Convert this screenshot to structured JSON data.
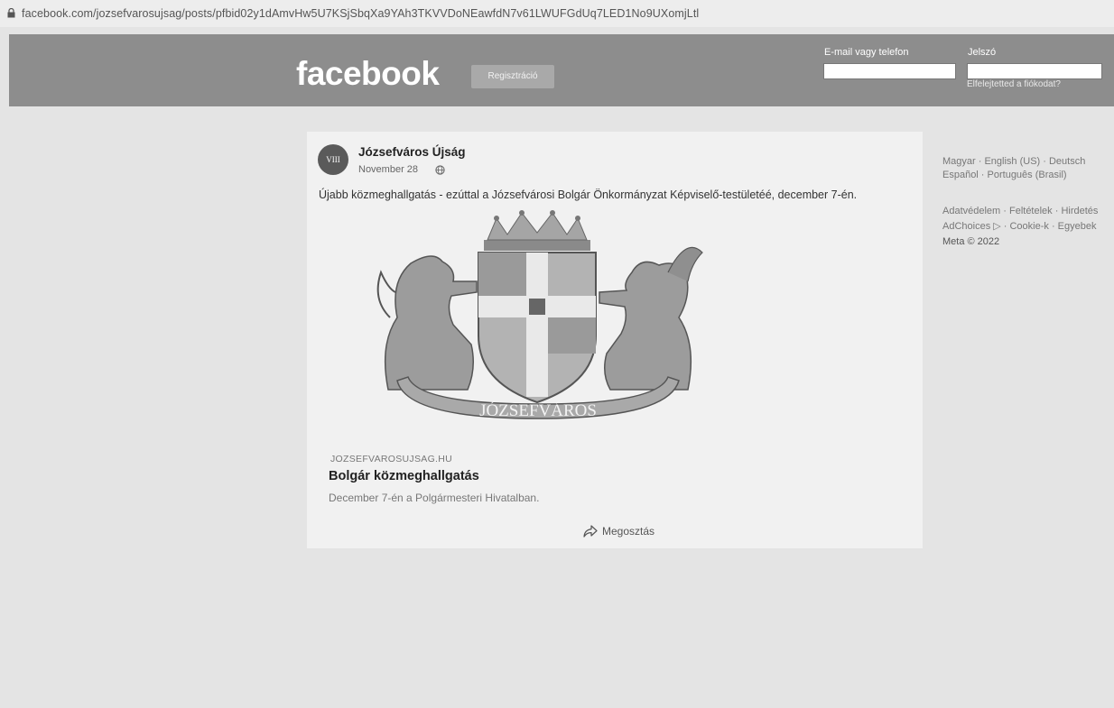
{
  "address_bar": {
    "url": "facebook.com/jozsefvarosujsag/posts/pfbid02y1dAmvHw5U7KSjSbqXa9YAh3TKVVDoNEawfdN7v61LWUFGdUq7LED1No9UXomjLtl"
  },
  "header": {
    "logo": "facebook",
    "register_button": "Regisztráció",
    "email_label": "E-mail vagy telefon",
    "password_label": "Jelszó",
    "email_value": "",
    "password_value": "",
    "forgot_link": "Elfelejtetted a fiókodat?"
  },
  "post": {
    "avatar_text": "VIII",
    "page_name": "Józsefváros Újság",
    "date": "November 28",
    "text": "Újabb közmeghallgatás - ezúttal a Józsefvárosi Bolgár Önkormányzat Képviselő-testületéé, december 7-én.",
    "image_ribbon_text": "JÓZSEFVÁROS",
    "link_domain": "JOZSEFVAROSUJSAG.HU",
    "link_title": "Bolgár közmeghallgatás",
    "link_description": "December 7-én a Polgármesteri Hivatalban.",
    "share_label": "Megosztás"
  },
  "sidebar": {
    "languages_line1": "Magyar · English (US) · Deutsch",
    "languages_line2": "Español · Português (Brasil)",
    "links_line1": "Adatvédelem · Feltételek · Hirdetés",
    "links_line2": "AdChoices ▷ · Cookie-k · Egyebek",
    "copyright": "Meta © 2022"
  }
}
